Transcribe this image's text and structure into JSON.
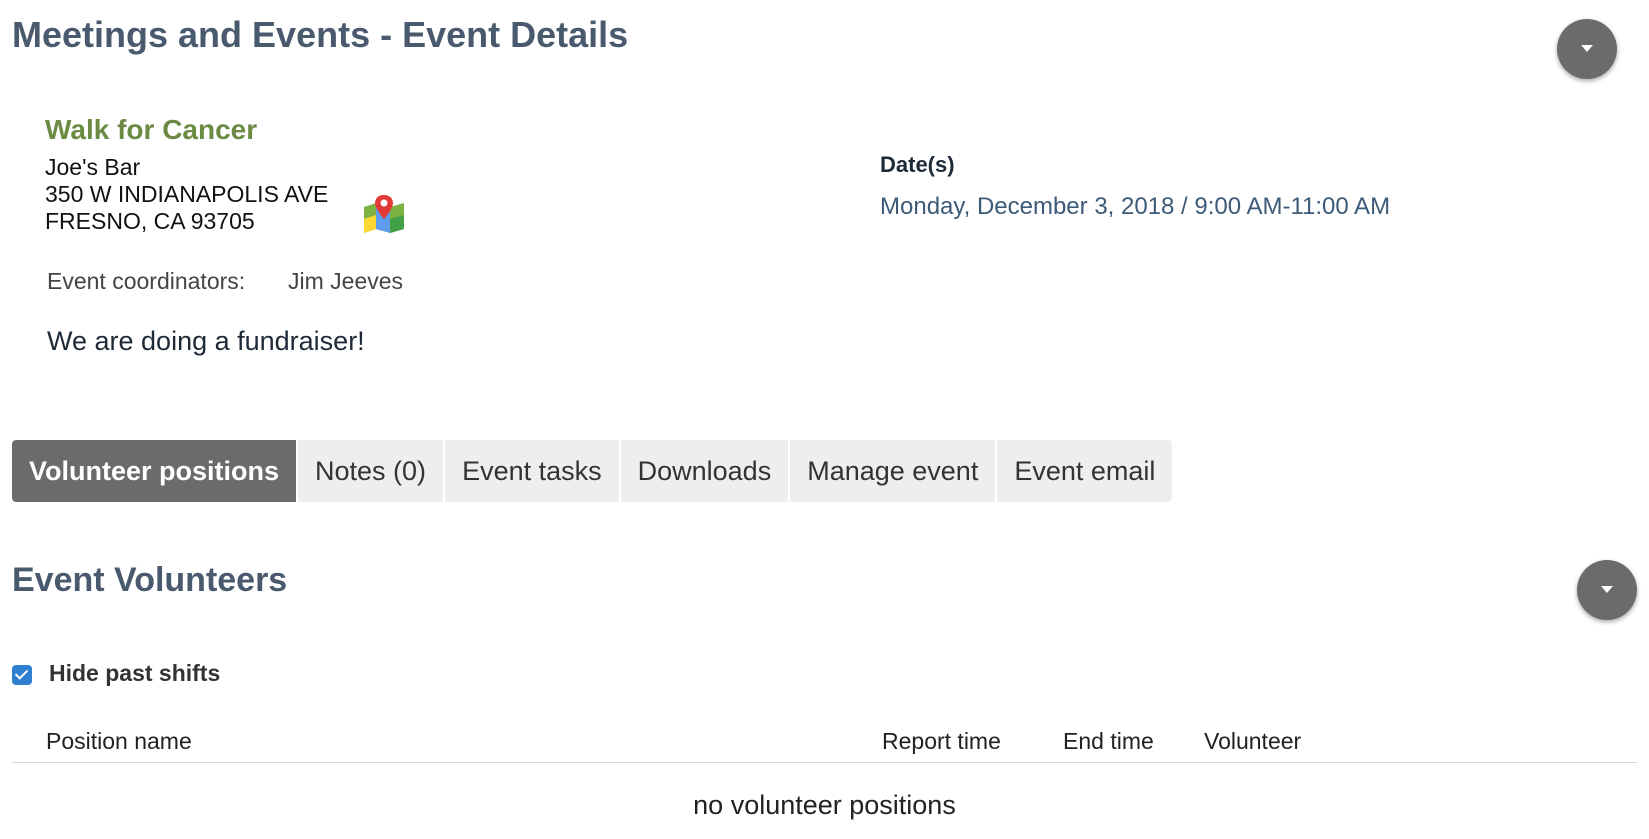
{
  "header": {
    "title": "Meetings and Events - Event Details",
    "menu_icon": "chevron-down-icon"
  },
  "event": {
    "name": "Walk for Cancer",
    "venue": "Joe's Bar",
    "address_line1": "350 W INDIANAPOLIS AVE",
    "address_line2": "FRESNO, CA 93705",
    "map_icon": "map-pin-icon",
    "coordinators_label": "Event coordinators:",
    "coordinators": "Jim Jeeves",
    "description": "We are doing a fundraiser!",
    "dates_label": "Date(s)",
    "dates": "Monday, December 3, 2018 / 9:00 AM-11:00 AM"
  },
  "tabs": [
    {
      "label": "Volunteer positions",
      "active": true
    },
    {
      "label": "Notes (0)",
      "active": false
    },
    {
      "label": "Event tasks",
      "active": false
    },
    {
      "label": "Downloads",
      "active": false
    },
    {
      "label": "Manage event",
      "active": false
    },
    {
      "label": "Event email",
      "active": false
    }
  ],
  "volunteers": {
    "title": "Event Volunteers",
    "hide_past_label": "Hide past shifts",
    "hide_past_checked": true,
    "columns": [
      "Position name",
      "Report time",
      "End time",
      "Volunteer"
    ],
    "empty_message": "no volunteer positions"
  },
  "colors": {
    "heading": "#4a5a6e",
    "event_name": "#6b8a43",
    "active_tab": "#6b6b6b",
    "inactive_tab": "#eeeeee",
    "checkbox": "#2f7fd3"
  }
}
